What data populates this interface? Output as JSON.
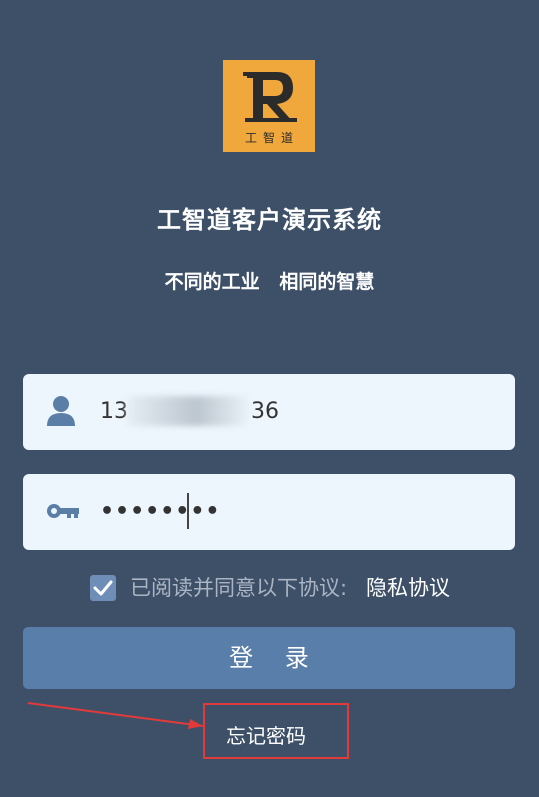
{
  "logo": {
    "text": "工智道"
  },
  "app_title": "工智道客户演示系统",
  "slogan": "不同的工业   相同的智慧",
  "username": {
    "prefix": "13",
    "suffix": "36"
  },
  "password": {
    "masked": "••••••••"
  },
  "agreement": {
    "checked": true,
    "text": "已阅读并同意以下协议:",
    "link": "隐私协议"
  },
  "login_button": "登 录",
  "forgot_password": "忘记密码",
  "colors": {
    "background": "#3d5068",
    "logo_bg": "#f0a73c",
    "field_bg": "#eef6fd",
    "button_bg": "#597ea9",
    "annotation": "#e23a3a"
  }
}
